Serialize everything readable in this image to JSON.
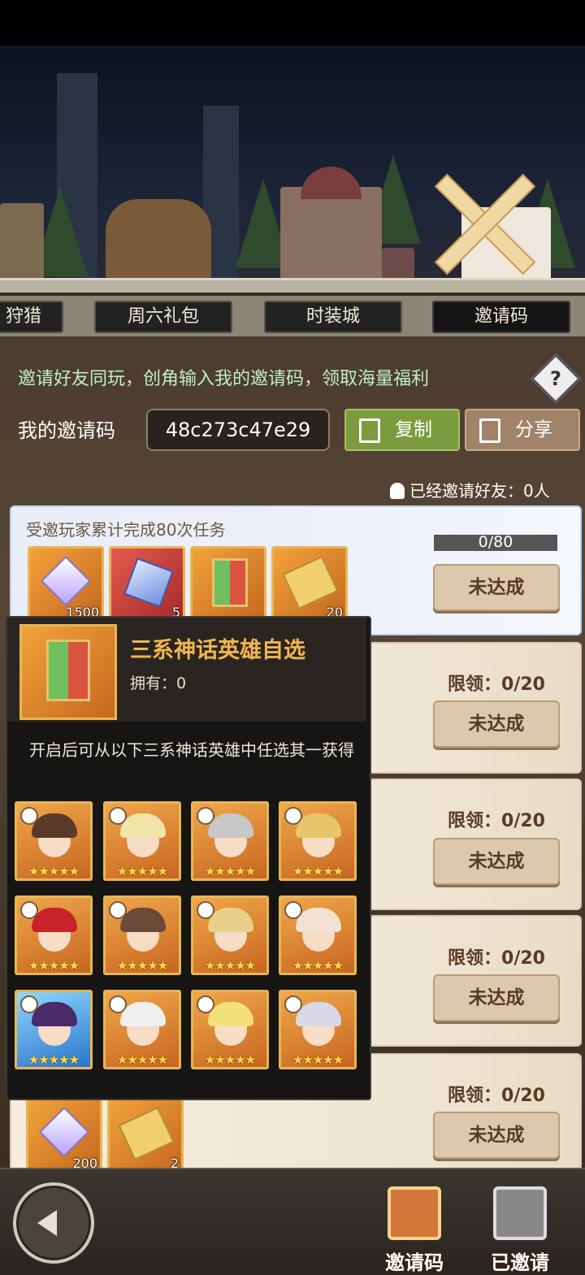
{
  "tabs": [
    "狩猎",
    "周六礼包",
    "时装城",
    "邀请码"
  ],
  "invite": {
    "intro": "邀请好友同玩，创角输入我的邀请码，领取海量福利",
    "help_icon": "?",
    "my_code_label": "我的邀请码",
    "code": "48c273c47e29",
    "copy_label": "复制",
    "share_label": "分享",
    "invited_count": "已经邀请好友：0人"
  },
  "tasks": [
    {
      "title": "受邀玩家累计完成80次任务",
      "progress": "0/80",
      "progress_fraction": 0,
      "button": "未达成",
      "rewards": [
        "1500",
        "5",
        "",
        "20"
      ]
    },
    {
      "limit": "限领：0/20",
      "button": "未达成"
    },
    {
      "limit": "限领：0/20",
      "button": "未达成"
    },
    {
      "limit": "限领：0/20",
      "button": "未达成"
    },
    {
      "limit": "限领：0/20",
      "button": "未达成",
      "rewards": [
        "200",
        "2"
      ]
    }
  ],
  "popup": {
    "title": "三系神话英雄自选",
    "owned": "拥有：0",
    "description": "开启后可从以下三系神话英雄中任选其一获得",
    "hero_stars": "★★★★★",
    "hero_count": 12
  },
  "nav": {
    "invite_code": "邀请码",
    "invited": "已邀请"
  },
  "colors": {
    "intro_text": "#bff0c4",
    "popup_title": "#f2b550",
    "copy_button": "#7c9b3e",
    "share_button": "#a1836a"
  }
}
